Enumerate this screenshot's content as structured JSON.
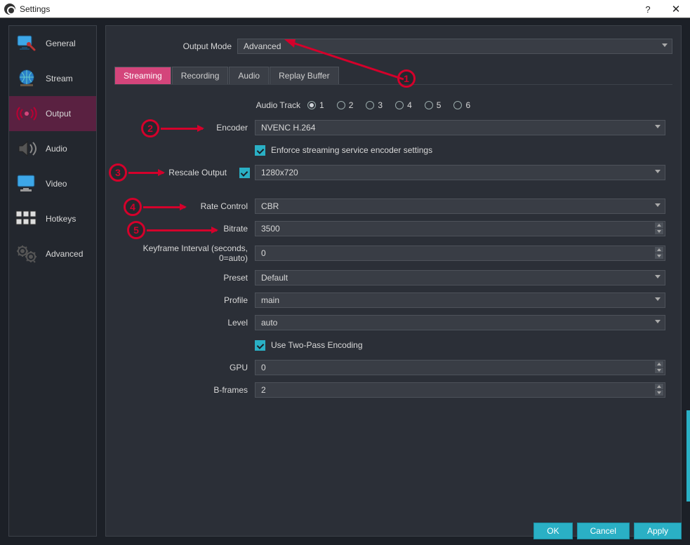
{
  "window": {
    "title": "Settings",
    "help": "?",
    "close": "✕"
  },
  "sidebar": {
    "items": [
      {
        "key": "general",
        "label": "General"
      },
      {
        "key": "stream",
        "label": "Stream"
      },
      {
        "key": "output",
        "label": "Output",
        "selected": true
      },
      {
        "key": "audio",
        "label": "Audio"
      },
      {
        "key": "video",
        "label": "Video"
      },
      {
        "key": "hotkeys",
        "label": "Hotkeys"
      },
      {
        "key": "advanced",
        "label": "Advanced"
      }
    ]
  },
  "main": {
    "output_mode_label": "Output Mode",
    "output_mode_value": "Advanced",
    "tabs": [
      "Streaming",
      "Recording",
      "Audio",
      "Replay Buffer"
    ],
    "active_tab": 0,
    "audio_track_label": "Audio Track",
    "audio_tracks": [
      "1",
      "2",
      "3",
      "4",
      "5",
      "6"
    ],
    "audio_track_selected": 0,
    "encoder_label": "Encoder",
    "encoder_value": "NVENC H.264",
    "enforce_label": "Enforce streaming service encoder settings",
    "enforce_checked": true,
    "rescale_label": "Rescale Output",
    "rescale_checked": true,
    "rescale_value": "1280x720",
    "rate_control_label": "Rate Control",
    "rate_control_value": "CBR",
    "bitrate_label": "Bitrate",
    "bitrate_value": "3500",
    "keyframe_label": "Keyframe Interval (seconds, 0=auto)",
    "keyframe_value": "0",
    "preset_label": "Preset",
    "preset_value": "Default",
    "profile_label": "Profile",
    "profile_value": "main",
    "level_label": "Level",
    "level_value": "auto",
    "twopass_label": "Use Two-Pass Encoding",
    "twopass_checked": true,
    "gpu_label": "GPU",
    "gpu_value": "0",
    "bframes_label": "B-frames",
    "bframes_value": "2"
  },
  "footer": {
    "ok": "OK",
    "cancel": "Cancel",
    "apply": "Apply"
  },
  "annotations": [
    "1",
    "2",
    "3",
    "4",
    "5"
  ]
}
